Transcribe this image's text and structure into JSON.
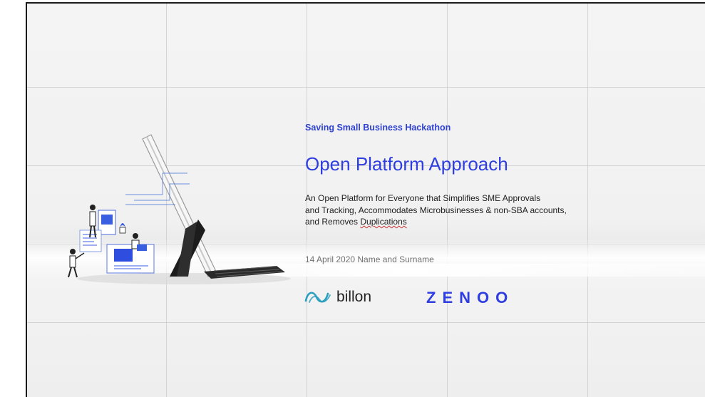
{
  "slide": {
    "subtitle": "Saving Small Business Hackathon",
    "title": "Open Platform Approach",
    "description_lines": [
      "An Open Platform for Everyone that Simplifies SME Approvals",
      "and Tracking, Accommodates Microbusinesses & non-SBA accounts,",
      "and Removes "
    ],
    "description_underlined": "Duplications",
    "date_line": "14 April 2020 Name and Surname",
    "logos": {
      "billon": "billon",
      "zenoo": "ZENOO"
    }
  },
  "colors": {
    "accent": "#2f3ee0",
    "text": "#1e1e1e",
    "muted": "#707070",
    "billon_icon": "#2a9fbf"
  },
  "icons": [
    "billon-wave-icon",
    "tablet-illustration",
    "people-illustration"
  ]
}
